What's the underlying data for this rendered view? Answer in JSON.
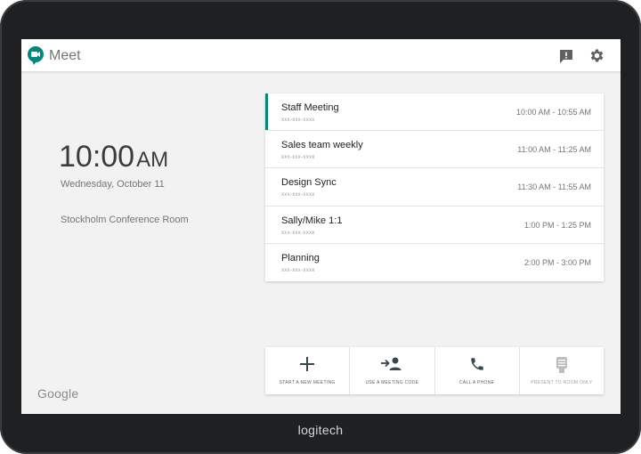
{
  "header": {
    "app_title": "Meet",
    "icons": [
      "google-meet-logo-icon",
      "feedback-icon",
      "gear-icon"
    ],
    "accent_color": "#00897b"
  },
  "status": {
    "time": "10:00",
    "ampm": "AM",
    "date": "Wednesday, October 11",
    "room": "Stockholm Conference Room"
  },
  "footer": {
    "google_logo_text": "Google",
    "device_brand": "logitech"
  },
  "meetings": [
    {
      "title": "Staff Meeting",
      "code": "xxx-xxx-xxxx",
      "time": "10:00 AM - 10:55 AM",
      "active": true
    },
    {
      "title": "Sales team weekly",
      "code": "xxx-xxx-xxxx",
      "time": "11:00 AM - 11:25 AM",
      "active": false
    },
    {
      "title": "Design Sync",
      "code": "xxx-xxx-xxxx",
      "time": "11:30 AM - 11:55 AM",
      "active": false
    },
    {
      "title": "Sally/Mike 1:1",
      "code": "xxx-xxx-xxxx",
      "time": "1:00 PM - 1:25 PM",
      "active": false
    },
    {
      "title": "Planning",
      "code": "xxx-xxx-xxxx",
      "time": "2:00 PM - 3:00 PM",
      "active": false
    }
  ],
  "actions": [
    {
      "label": "START A NEW MEETING",
      "icon": "plus-icon"
    },
    {
      "label": "USE A MEETING CODE",
      "icon": "person-join-icon"
    },
    {
      "label": "CALL A PHONE",
      "icon": "phone-icon"
    },
    {
      "label": "PRESENT TO ROOM ONLY",
      "icon": "present-icon"
    }
  ]
}
